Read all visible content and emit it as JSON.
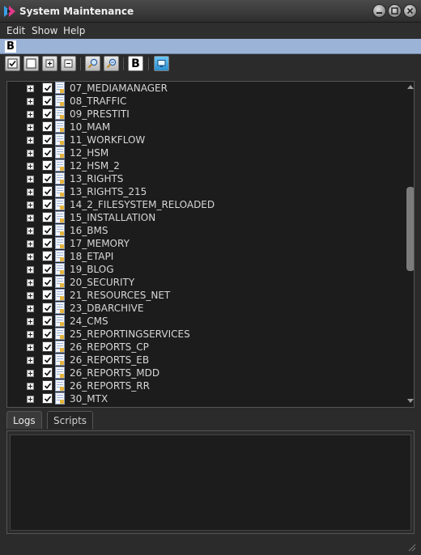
{
  "window": {
    "title": "System Maintenance",
    "logo_icon": "app-logo-icon",
    "controls": [
      "minimize-icon",
      "maximize-icon",
      "close-icon"
    ]
  },
  "menu": {
    "items": [
      "Edit",
      "Show",
      "Help"
    ]
  },
  "addressbar": {
    "badge": "B",
    "accent_color": "#9bb3d6"
  },
  "toolbar": {
    "buttons": [
      {
        "name": "check-all-icon"
      },
      {
        "name": "uncheck-all-icon"
      },
      {
        "name": "expand-all-icon"
      },
      {
        "name": "collapse-all-icon"
      },
      {
        "name": "zoom-in-icon"
      },
      {
        "name": "zoom-out-icon"
      },
      {
        "name": "bold-b-icon",
        "label": "B"
      },
      {
        "name": "monitor-icon"
      }
    ]
  },
  "tree": {
    "items": [
      {
        "label": "07_MEDIAMANAGER",
        "checked": true
      },
      {
        "label": "08_TRAFFIC",
        "checked": true
      },
      {
        "label": "09_PRESTITI",
        "checked": true
      },
      {
        "label": "10_MAM",
        "checked": true
      },
      {
        "label": "11_WORKFLOW",
        "checked": true
      },
      {
        "label": "12_HSM",
        "checked": true
      },
      {
        "label": "12_HSM_2",
        "checked": true
      },
      {
        "label": "13_RIGHTS",
        "checked": true
      },
      {
        "label": "13_RIGHTS_215",
        "checked": true
      },
      {
        "label": "14_2_FILESYSTEM_RELOADED",
        "checked": true
      },
      {
        "label": "15_INSTALLATION",
        "checked": true
      },
      {
        "label": "16_BMS",
        "checked": true
      },
      {
        "label": "17_MEMORY",
        "checked": true
      },
      {
        "label": "18_ETAPI",
        "checked": true
      },
      {
        "label": "19_BLOG",
        "checked": true
      },
      {
        "label": "20_SECURITY",
        "checked": true
      },
      {
        "label": "21_RESOURCES_NET",
        "checked": true
      },
      {
        "label": "23_DBARCHIVE",
        "checked": true
      },
      {
        "label": "24_CMS",
        "checked": true
      },
      {
        "label": "25_REPORTINGSERVICES",
        "checked": true
      },
      {
        "label": "26_REPORTS_CP",
        "checked": true
      },
      {
        "label": "26_REPORTS_EB",
        "checked": true
      },
      {
        "label": "26_REPORTS_MDD",
        "checked": true
      },
      {
        "label": "26_REPORTS_RR",
        "checked": true
      },
      {
        "label": "30_MTX",
        "checked": true
      }
    ]
  },
  "tabs": {
    "items": [
      {
        "label": "Logs",
        "active": true
      },
      {
        "label": "Scripts",
        "active": false
      }
    ]
  }
}
